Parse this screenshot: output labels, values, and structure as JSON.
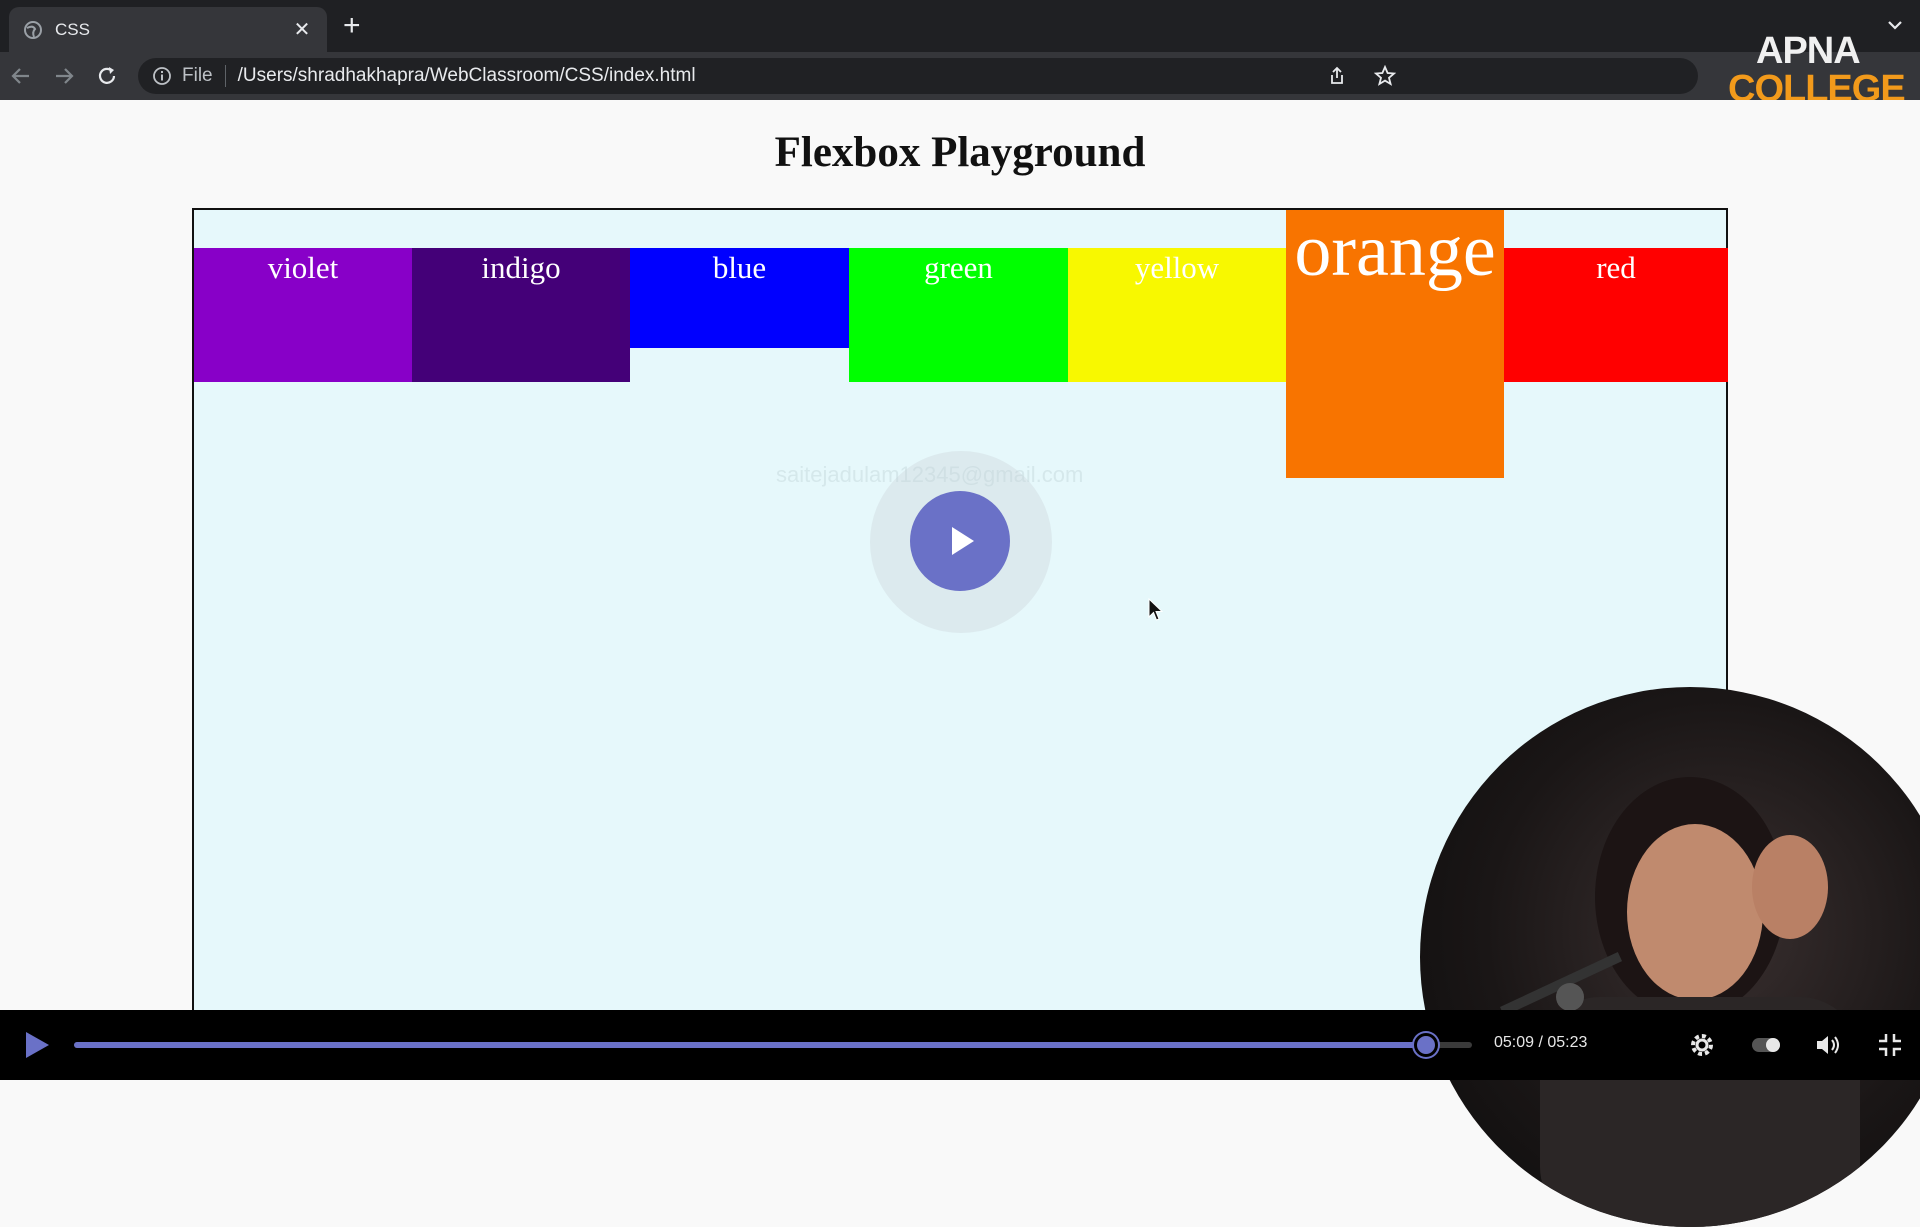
{
  "browser": {
    "tab_title": "CSS",
    "close_glyph": "✕",
    "new_tab_glyph": "+",
    "url_scheme": "File",
    "url_path": "/Users/shradhakhapra/WebClassroom/CSS/index.html"
  },
  "branding": {
    "line1": "APNA",
    "line2": "COLLEGE"
  },
  "page": {
    "title": "Flexbox Playground",
    "watermark": "saitejadulam12345@gmail.com",
    "boxes": [
      {
        "label": "violet",
        "color": "#8800c8"
      },
      {
        "label": "indigo",
        "color": "#440078"
      },
      {
        "label": "blue",
        "color": "#0000ff"
      },
      {
        "label": "green",
        "color": "#00ff00"
      },
      {
        "label": "yellow",
        "color": "#f8f800"
      },
      {
        "label": "orange",
        "color": "#f87400"
      },
      {
        "label": "red",
        "color": "#ff0000"
      }
    ]
  },
  "player": {
    "time": "05:09 / 05:23",
    "progress_fraction": 0.967,
    "accent_color": "#6a71c7"
  }
}
